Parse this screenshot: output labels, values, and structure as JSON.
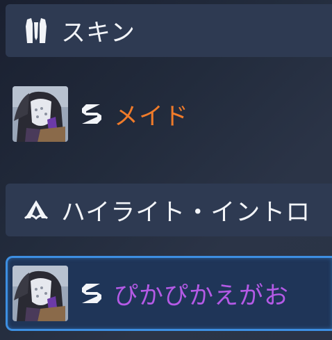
{
  "sections": {
    "skin": {
      "title": "スキン",
      "icon": "armor-icon",
      "item": {
        "name": "メイド",
        "color": "#f07b2a",
        "rarity_icon": "s-rarity-icon"
      }
    },
    "highlight": {
      "title": "ハイライト・イントロ",
      "icon": "highlight-icon",
      "item": {
        "name": "ぴかぴかえがお",
        "color": "#b45ae6",
        "rarity_icon": "s-rarity-icon",
        "selected": true
      }
    }
  },
  "colors": {
    "header_bg": "#2e3a52",
    "selected_border": "#3d8fe2",
    "epic": "#b45ae6",
    "legendary": "#f07b2a"
  }
}
